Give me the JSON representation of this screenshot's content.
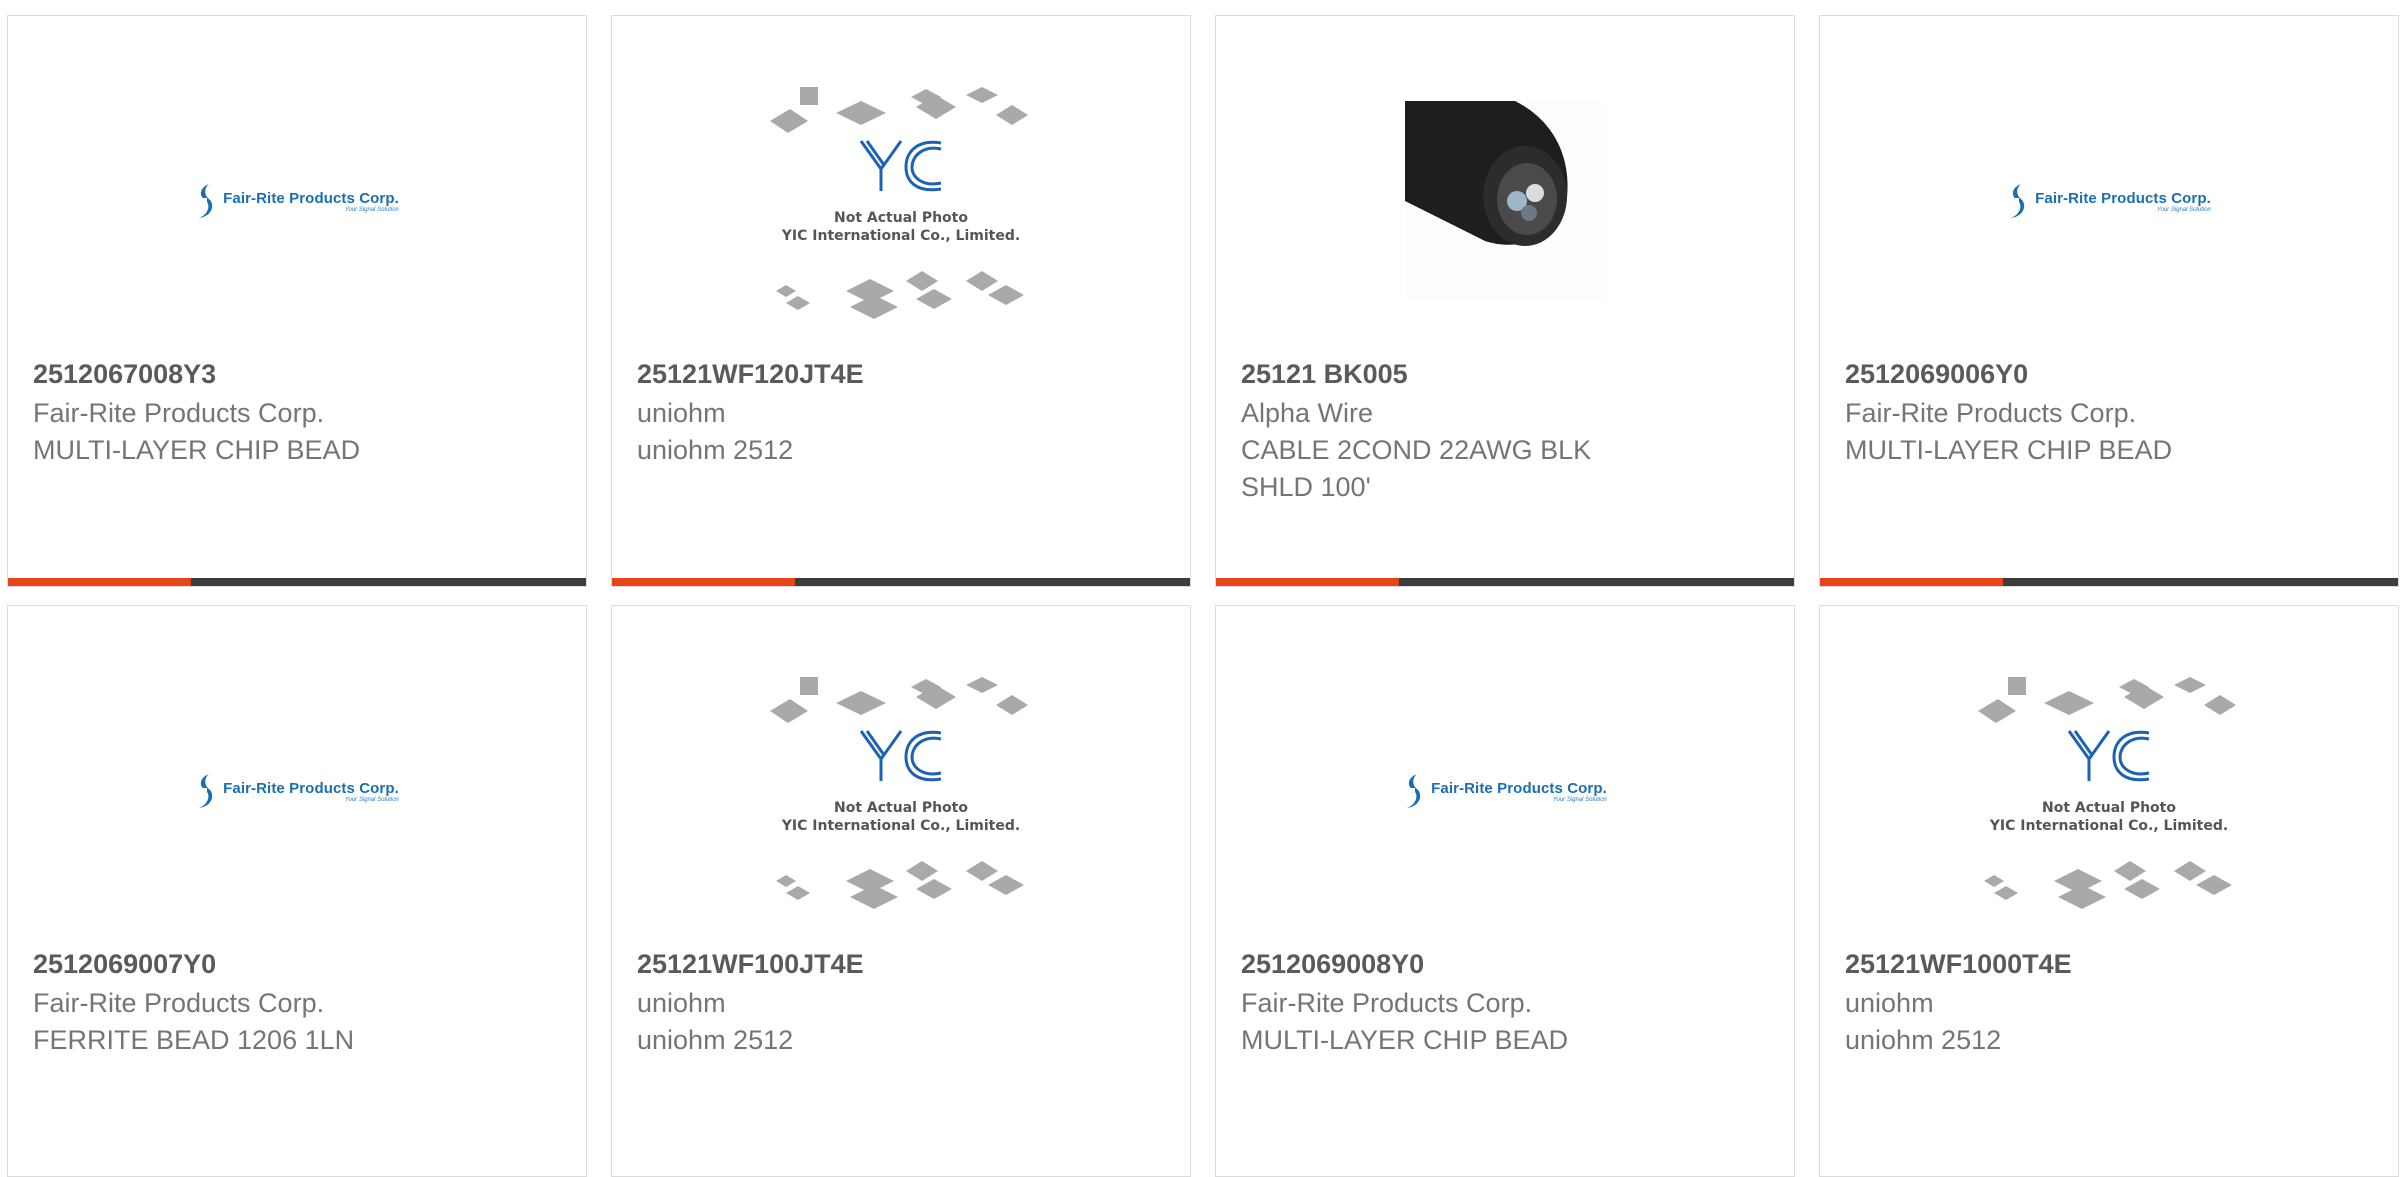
{
  "products": [
    {
      "part_number": "2512067008Y3",
      "manufacturer": "Fair-Rite Products Corp.",
      "description": "MULTI-LAYER CHIP BEAD",
      "image": "fair-rite-logo"
    },
    {
      "part_number": "25121WF120JT4E",
      "manufacturer": "uniohm",
      "description": "uniohm 2512",
      "image": "yic-placeholder"
    },
    {
      "part_number": "25121 BK005",
      "manufacturer": "Alpha Wire",
      "description": "CABLE 2COND 22AWG BLK SHLD 100'",
      "image": "cable-photo"
    },
    {
      "part_number": "2512069006Y0",
      "manufacturer": "Fair-Rite Products Corp.",
      "description": "MULTI-LAYER CHIP BEAD",
      "image": "fair-rite-logo"
    },
    {
      "part_number": "2512069007Y0",
      "manufacturer": "Fair-Rite Products Corp.",
      "description": "FERRITE BEAD 1206 1LN",
      "image": "fair-rite-logo"
    },
    {
      "part_number": "25121WF100JT4E",
      "manufacturer": "uniohm",
      "description": "uniohm 2512",
      "image": "yic-placeholder"
    },
    {
      "part_number": "2512069008Y0",
      "manufacturer": "Fair-Rite Products Corp.",
      "description": "MULTI-LAYER CHIP BEAD",
      "image": "fair-rite-logo"
    },
    {
      "part_number": "25121WF1000T4E",
      "manufacturer": "uniohm",
      "description": "uniohm 2512",
      "image": "yic-placeholder"
    }
  ],
  "logos": {
    "fair_rite_name": "Fair-Rite Products Corp.",
    "fair_rite_tagline": "Your Signal Solution",
    "yic_line1": "Not Actual Photo",
    "yic_line2": "YIC International Co., Limited."
  },
  "colors": {
    "accent": "#e8431b",
    "bar": "#3d3d3d",
    "fair_rite_blue": "#1a6fb0",
    "yic_blue": "#1d63b5"
  }
}
